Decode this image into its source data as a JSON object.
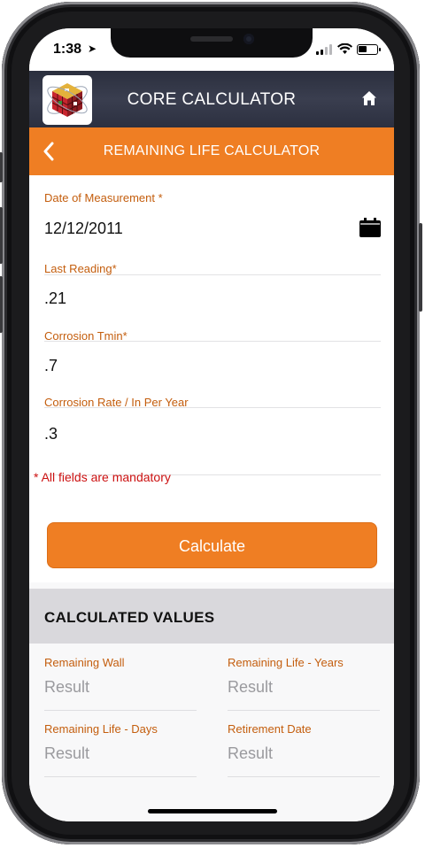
{
  "status_bar": {
    "time": "1:38",
    "location_glyph": "➤"
  },
  "app_header": {
    "title": "CORE CALCULATOR",
    "logo_icon": "rubik-cube-icon",
    "home_icon": "home-icon"
  },
  "page_header": {
    "title": "REMAINING LIFE CALCULATOR",
    "back_icon": "chevron-left-icon"
  },
  "form": {
    "fields": [
      {
        "label": "Date of Measurement *",
        "value": "12/12/2011"
      },
      {
        "label": "Last Reading*",
        "value": ".21"
      },
      {
        "label": "Corrosion Tmin*",
        "value": ".7"
      },
      {
        "label": "Corrosion Rate / In Per Year",
        "value": ".3"
      }
    ],
    "mandatory_note": "* All fields are mandatory",
    "calculate_label": "Calculate"
  },
  "calculated": {
    "title": "CALCULATED VALUES",
    "results": [
      {
        "label": "Remaining Wall",
        "value": "Result"
      },
      {
        "label": "Remaining Life - Years",
        "value": "Result"
      },
      {
        "label": "Remaining Life - Days",
        "value": "Result"
      },
      {
        "label": "Retirement Date",
        "value": "Result"
      }
    ]
  },
  "colors": {
    "accent": "#ef7e23",
    "label": "#c45e0e",
    "header_bg": "#2b2f3e",
    "error": "#cc1111"
  }
}
